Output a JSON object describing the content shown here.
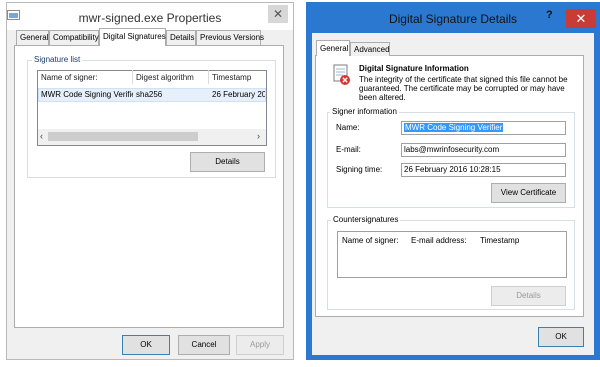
{
  "properties_window": {
    "title": "mwr-signed.exe Properties",
    "close_glyph": "✕",
    "tabs": [
      {
        "label": "General"
      },
      {
        "label": "Compatibility"
      },
      {
        "label": "Digital Signatures"
      },
      {
        "label": "Details"
      },
      {
        "label": "Previous Versions"
      }
    ],
    "active_tab": "Digital Signatures",
    "signature_list": {
      "group_label": "Signature list",
      "columns": [
        "Name of signer:",
        "Digest algorithm",
        "Timestamp"
      ],
      "rows": [
        {
          "name": "MWR Code Signing Verifier",
          "digest": "sha256",
          "timestamp": "26 February 20"
        }
      ],
      "scroll_left": "‹",
      "scroll_right": "›"
    },
    "details_button": "Details",
    "footer_buttons": {
      "ok": "OK",
      "cancel": "Cancel",
      "apply": "Apply"
    }
  },
  "signature_details_window": {
    "title": "Digital Signature Details",
    "help_glyph": "?",
    "close_glyph": "✕",
    "tabs": [
      {
        "label": "General"
      },
      {
        "label": "Advanced"
      }
    ],
    "active_tab": "General",
    "info": {
      "heading": "Digital Signature Information",
      "description": "The integrity of the certificate that signed this file cannot be guaranteed. The certificate may be corrupted or may have been altered."
    },
    "signer_information": {
      "group_label": "Signer information",
      "name_label": "Name:",
      "name_value": "MWR Code Signing Verifier",
      "email_label": "E-mail:",
      "email_value": "labs@mwrinfosecurity.com",
      "signing_time_label": "Signing time:",
      "signing_time_value": "26 February 2016 10:28:15",
      "view_certificate_button": "View Certificate"
    },
    "countersignatures": {
      "group_label": "Countersignatures",
      "columns": [
        "Name of signer:",
        "E-mail address:",
        "Timestamp"
      ],
      "details_button": "Details"
    },
    "ok_button": "OK"
  },
  "colors": {
    "accent_frame": "#2b78d0",
    "close_red": "#c83b36",
    "selection": "#3399ff",
    "row_highlight": "#e5f0fb"
  }
}
